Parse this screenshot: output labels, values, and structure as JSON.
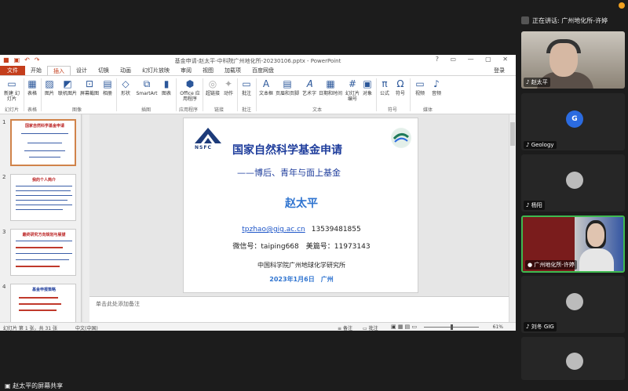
{
  "meeting": {
    "speaking_label": "正在讲话: 广州地化所-许婷",
    "share_label": "赵太平的屏幕共享",
    "participants": [
      {
        "name": "赵太平",
        "type": "video"
      },
      {
        "name": "Geology",
        "avatar": "G",
        "type": "avatar"
      },
      {
        "name": "杨阳",
        "type": "photo"
      },
      {
        "name": "广州地化所-许婷",
        "type": "video"
      },
      {
        "name": "刘冬 GIG",
        "type": "photo"
      },
      {
        "name": "",
        "type": "photo"
      }
    ]
  },
  "ppt": {
    "window_title": "基金申请-赵太平-中科院广州地化所-20230106.pptx - PowerPoint",
    "menu_tabs": [
      "文件",
      "开始",
      "插入",
      "设计",
      "切换",
      "动画",
      "幻灯片放映",
      "审阅",
      "视图",
      "加载项",
      "百度网盘"
    ],
    "active_tab": "插入",
    "login": "登录",
    "ribbon_groups": {
      "slides": "幻灯片",
      "tables": "表格",
      "images": "图像",
      "illustrations": "插图",
      "apps": "应用程序",
      "links": "链接",
      "comments": "批注",
      "text": "文本",
      "symbols": "符号",
      "media": "媒体"
    },
    "ribbon_buttons": {
      "new_slide": "新建\n幻灯片",
      "table": "表格",
      "picture": "图片",
      "online_pic": "联机图片",
      "screenshot": "屏幕截图",
      "album": "相册",
      "shapes": "形状",
      "smartart": "SmartArt",
      "chart": "图表",
      "office_apps": "Office\n应用程序",
      "hyperlink": "超链接",
      "action": "动作",
      "comment": "批注",
      "textbox": "文本框",
      "header_footer": "页眉和页脚",
      "wordart": "艺术字",
      "datetime": "日期和时间",
      "slide_num": "幻灯片\n编号",
      "object": "对象",
      "equation": "公式",
      "symbol": "符号",
      "video": "视频",
      "audio": "音频"
    },
    "thumbnails": [
      {
        "num": "1",
        "title": "国家自然科学基金申请"
      },
      {
        "num": "2",
        "title": "我的个人简介"
      },
      {
        "num": "3",
        "title": "最终研究方向规划与展望"
      },
      {
        "num": "4",
        "title": "基金申报策略"
      }
    ],
    "slide": {
      "logo_text": "NSFC",
      "title": "国家自然科学基金申请",
      "subtitle": "——博后、青年与面上基金",
      "name": "赵太平",
      "email": "tpzhao@gig.ac.cn",
      "phone": "13539481855",
      "wechat": "微信号：taiping668　美篇号：11973143",
      "org": "中国科学院广州地球化学研究所",
      "date": "2023年1月6日　广州"
    },
    "notes_placeholder": "单击此处添加备注",
    "status": {
      "slide_info": "幻灯片 第 1 张，共 31 张",
      "language": "中文(中国)",
      "notes": "备注",
      "comments": "批注",
      "zoom": "61%"
    }
  },
  "colors": {
    "accent": "#c43e1c",
    "title_blue": "#1e3d9c",
    "name_blue": "#2f74d0",
    "active_border": "#3fb950"
  }
}
